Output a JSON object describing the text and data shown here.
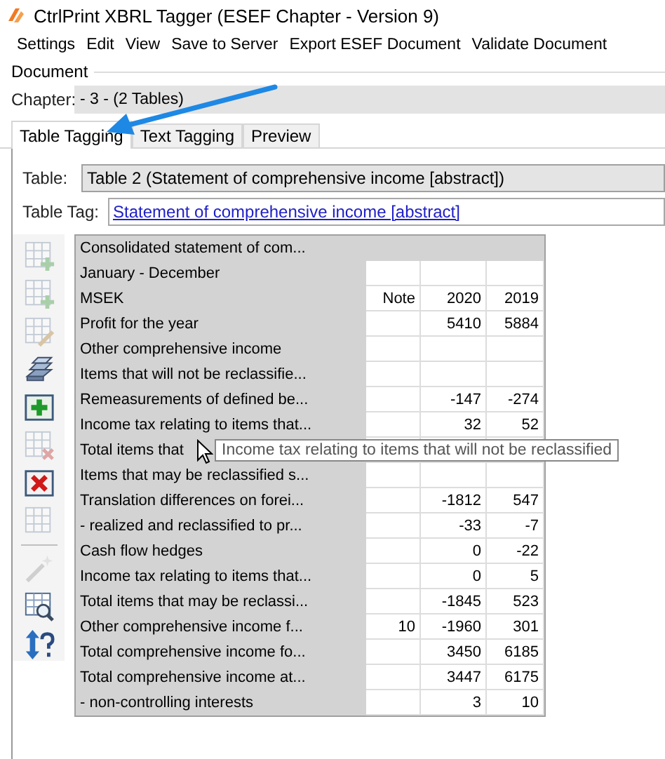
{
  "window": {
    "title": "CtrlPrint XBRL Tagger (ESEF Chapter - Version 9)"
  },
  "menu": [
    "Settings",
    "Edit",
    "View",
    "Save to Server",
    "Export ESEF Document",
    "Validate Document"
  ],
  "document_group": {
    "label": "Document"
  },
  "chapter": {
    "label": "Chapter:",
    "value": "- 3 - (2 Tables)"
  },
  "tabs": [
    {
      "label": "Table Tagging",
      "selected": true
    },
    {
      "label": "Text Tagging",
      "selected": false
    },
    {
      "label": "Preview",
      "selected": false
    }
  ],
  "table_field": {
    "label": "Table:",
    "value": "Table 2 (Statement of comprehensive income [abstract])"
  },
  "table_tag": {
    "label": "Table Tag:",
    "value": "Statement of comprehensive income [abstract]"
  },
  "toolbar": [
    {
      "kind": "table-add",
      "disabled": true
    },
    {
      "kind": "table-add",
      "disabled": true
    },
    {
      "kind": "table-edit",
      "disabled": true
    },
    {
      "kind": "stack",
      "disabled": false
    },
    {
      "kind": "add",
      "disabled": false
    },
    {
      "kind": "table-remove",
      "disabled": true
    },
    {
      "kind": "delete",
      "disabled": false
    },
    {
      "kind": "table",
      "disabled": true
    },
    {
      "kind": "wand",
      "disabled": true
    },
    {
      "kind": "table-search",
      "disabled": false
    },
    {
      "kind": "sort-help",
      "disabled": false
    }
  ],
  "grid": {
    "rows": [
      {
        "kind": "heading",
        "label": "Consolidated statement of com..."
      },
      {
        "kind": "data",
        "label": "January - December"
      },
      {
        "kind": "data",
        "label": "MSEK",
        "note": "Note",
        "y2020": "2020",
        "y2019": "2019"
      },
      {
        "kind": "data",
        "label": "Profit for the year",
        "y2020": "5410",
        "y2019": "5884"
      },
      {
        "kind": "data",
        "label": "Other comprehensive income"
      },
      {
        "kind": "data",
        "label": "Items that will not be reclassifie..."
      },
      {
        "kind": "data",
        "label": "Remeasurements of defined be...",
        "y2020": "-147",
        "y2019": "-274"
      },
      {
        "kind": "data",
        "label": "Income tax relating to items that...",
        "y2020": "32",
        "y2019": "52"
      },
      {
        "kind": "data",
        "label": "Total items that"
      },
      {
        "kind": "data",
        "label": "Items that may be reclassified s..."
      },
      {
        "kind": "data",
        "label": "Translation differences on forei...",
        "y2020": "-1812",
        "y2019": "547"
      },
      {
        "kind": "data",
        "label": "- realized and reclassified to pr...",
        "y2020": "-33",
        "y2019": "-7"
      },
      {
        "kind": "data",
        "label": "Cash flow hedges",
        "y2020": "0",
        "y2019": "-22"
      },
      {
        "kind": "data",
        "label": "Income tax relating to items that...",
        "y2020": "0",
        "y2019": "5"
      },
      {
        "kind": "data",
        "label": "Total items that may be reclassi...",
        "y2020": "-1845",
        "y2019": "523"
      },
      {
        "kind": "data",
        "label": "Other comprehensive income f...",
        "note": "10",
        "y2020": "-1960",
        "y2019": "301"
      },
      {
        "kind": "data",
        "label": "Total comprehensive income fo...",
        "y2020": "3450",
        "y2019": "6185"
      },
      {
        "kind": "data",
        "label": "Total comprehensive income at...",
        "y2020": "3447",
        "y2019": "6175"
      },
      {
        "kind": "data",
        "label": "- non-controlling interests",
        "y2020": "3",
        "y2019": "10"
      }
    ]
  },
  "tooltip": {
    "text": "Income tax relating to items that will not be reclassified"
  }
}
